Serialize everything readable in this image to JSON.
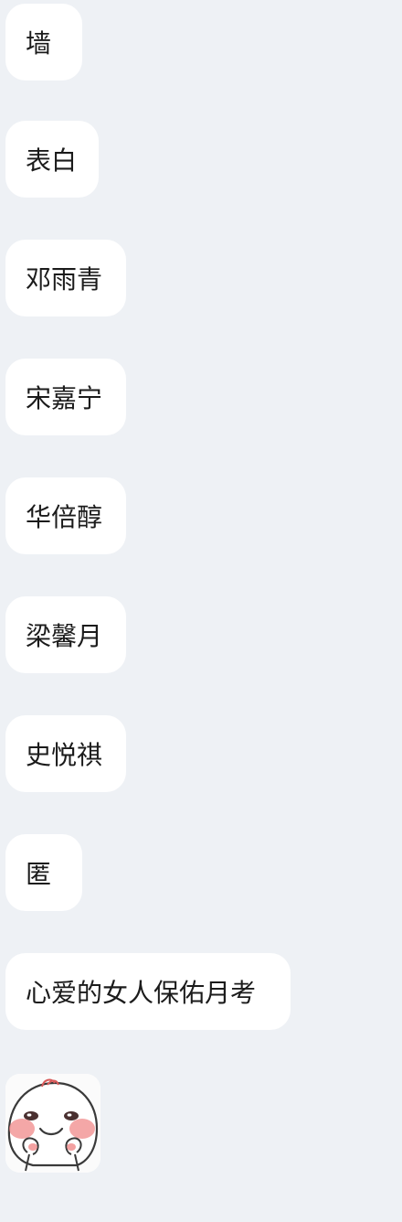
{
  "chat": {
    "messages": [
      {
        "text": "墙"
      },
      {
        "text": "表白"
      },
      {
        "text": "邓雨青"
      },
      {
        "text": "宋嘉宁"
      },
      {
        "text": "华倍醇"
      },
      {
        "text": "梁馨月"
      },
      {
        "text": "史悦祺"
      },
      {
        "text": "匿"
      },
      {
        "text": "心爱的女人保佑月考"
      }
    ],
    "sticker": {
      "icon": "blushing-face-sticker-icon"
    }
  },
  "colors": {
    "background": "#eef1f5",
    "bubble": "#ffffff",
    "text": "#1b1b1b",
    "blush": "#f08a8a"
  }
}
